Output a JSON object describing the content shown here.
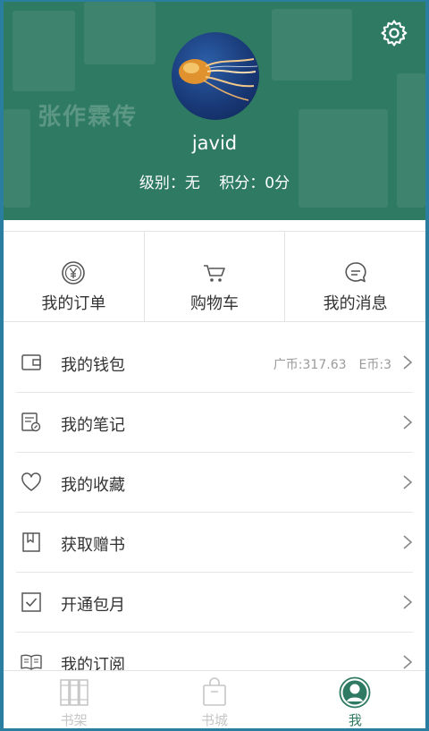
{
  "header": {
    "background_text": "张作霖传",
    "username": "javid",
    "level_label": "级别：无",
    "points_label": "积分：0分"
  },
  "quick_actions": [
    {
      "label": "我的订单",
      "icon": "yen-circle-icon"
    },
    {
      "label": "购物车",
      "icon": "cart-icon"
    },
    {
      "label": "我的消息",
      "icon": "message-icon"
    }
  ],
  "menu": [
    {
      "label": "我的钱包",
      "icon": "wallet-icon",
      "extra1": "广币:317.63",
      "extra2": "E币:3"
    },
    {
      "label": "我的笔记",
      "icon": "note-icon"
    },
    {
      "label": "我的收藏",
      "icon": "heart-icon"
    },
    {
      "label": "获取赠书",
      "icon": "bookmark-icon"
    },
    {
      "label": "开通包月",
      "icon": "checkbox-icon"
    },
    {
      "label": "我的订阅",
      "icon": "open-book-icon"
    }
  ],
  "nav": [
    {
      "label": "书架",
      "icon": "bookshelf-icon",
      "active": false
    },
    {
      "label": "书城",
      "icon": "shopping-bag-icon",
      "active": false
    },
    {
      "label": "我",
      "icon": "profile-icon",
      "active": true
    }
  ],
  "colors": {
    "brand": "#2f7a62",
    "text": "#333333",
    "muted": "#9a9a9a",
    "inactive": "#c6c6c6",
    "frame": "#2a7fa0"
  }
}
